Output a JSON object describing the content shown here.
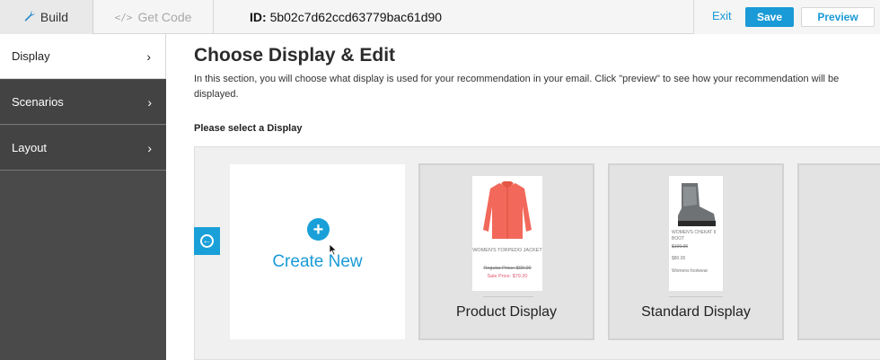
{
  "header": {
    "tabs": [
      {
        "label": "Build",
        "icon": "wrench-icon"
      },
      {
        "label": "Get Code",
        "icon": "code-icon"
      }
    ],
    "id_prefix": "ID:",
    "id_value": "5b02c7d62ccd63779bac61d90",
    "exit_label": "Exit",
    "save_label": "Save",
    "preview_label": "Preview"
  },
  "sidebar": {
    "items": [
      {
        "label": "Display",
        "active": true
      },
      {
        "label": "Scenarios",
        "active": false
      },
      {
        "label": "Layout",
        "active": false
      }
    ]
  },
  "main": {
    "title": "Choose Display & Edit",
    "description": "In this section, you will choose what display is used for your recommendation in your email. Click \"preview\" to see how your recommendation will be displayed.",
    "select_label": "Please select a Display",
    "create_new_label": "Create New",
    "cards": [
      {
        "label": "Product Display",
        "product_name": "WOMEN'S TORPEDO JACKET",
        "regular_price": "Regular Price: $99.00",
        "sale_price": "Sale Price: $79.20"
      },
      {
        "label": "Standard Display",
        "product_name": "WOMEN'S CHEKAT II BOOT",
        "old_price": "$100.00",
        "price": "$80.00",
        "category": "Womens footwear"
      }
    ]
  },
  "colors": {
    "accent": "#1a9ad6",
    "sidebar_bg": "#4a4a4a",
    "sale": "#e2576e"
  }
}
